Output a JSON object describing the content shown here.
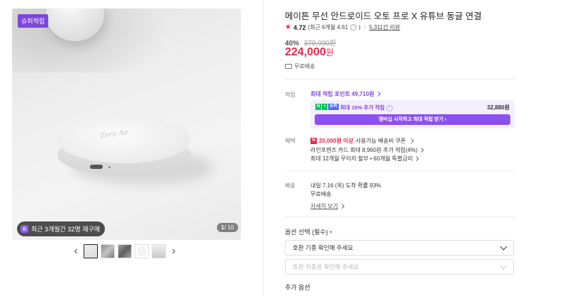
{
  "gallery": {
    "badge_top": "슈퍼적립",
    "badge_bottom": "최근 3개월간 32명 재구매",
    "counter_current": "1",
    "counter_total": "/ 10",
    "thumb_count": 5,
    "device_logo_text": "Zero Ae"
  },
  "product": {
    "title": "메이튼 무선 안드로이드 오토 프로 X 유튜브 동글 연결",
    "rating": "4.72",
    "rating_recent": "(최근 6개월 4.61",
    "reviews": "5,311건 리뷰",
    "discount_pct": "40%",
    "original_price": "379,000원",
    "price": "224,000",
    "price_unit": "원",
    "shipping_label": "무료배송"
  },
  "point": {
    "label": "적립",
    "max_point": "최대 적립 포인트 49,710원",
    "npay_badges": [
      "N",
      "+",
      "슈퍼"
    ],
    "extra": "최대 15% 추가 적립",
    "amount": "32,880원",
    "member_button": "멤버십 시작하고 최대 적립 받기"
  },
  "benefit": {
    "label": "혜택",
    "coupon_icon": "N",
    "coupon_red": "20,000원 이상",
    "coupon_rest": "사용가능 배송비 쿠폰",
    "card": "라인프렌즈 카드 최대 8,960원 추가 적립(4%)",
    "installment": "최대 12개월 무이자 할부 • 60개월 특별금리"
  },
  "delivery": {
    "label": "배송",
    "arrival": "내일 7.16 (목) 도착 확률 93%",
    "fee": "무료배송",
    "detail": "자세히 보기"
  },
  "options": {
    "title": "옵션 선택 (필수)",
    "required_mark": "•",
    "select1": "호환 기종 확인해 주세요",
    "select2": "호환 차종을 확인해 주세요",
    "extra_title": "추가 옵션"
  },
  "colors": {
    "accent_purple": "#7d47d9",
    "price_red": "#e8294b",
    "npay_green": "#03c75a"
  }
}
